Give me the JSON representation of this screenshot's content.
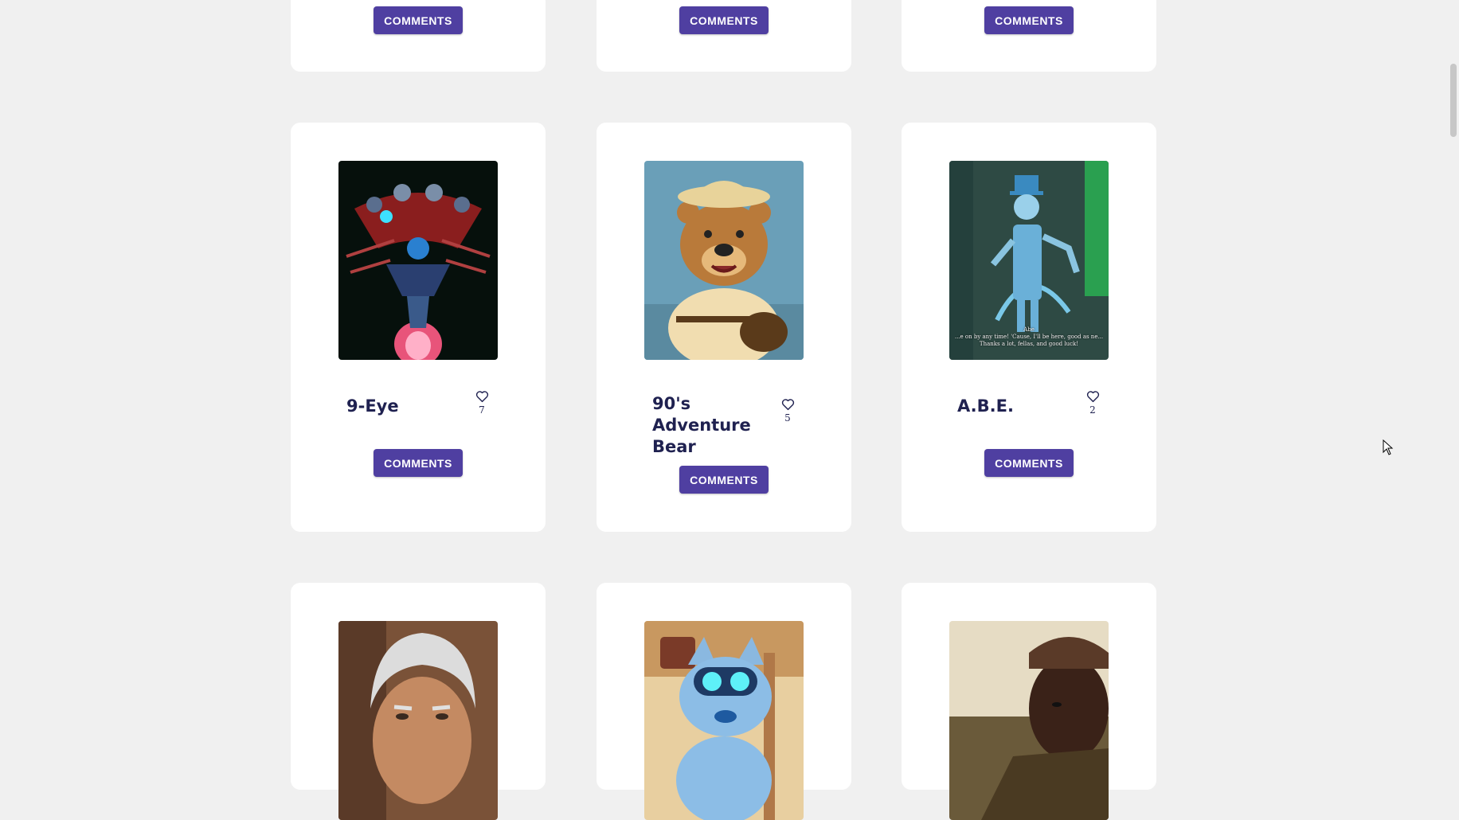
{
  "colors": {
    "page_bg": "#f0f0f0",
    "card_bg": "#ffffff",
    "accent": "#4f3fa1",
    "title_text": "#1f2150"
  },
  "button_label": "COMMENTS",
  "top_row": [
    {
      "button": "COMMENTS"
    },
    {
      "button": "COMMENTS"
    },
    {
      "button": "COMMENTS"
    }
  ],
  "characters": [
    {
      "name": "9-Eye",
      "likes": "7",
      "button": "COMMENTS",
      "image": "robot-camera-image"
    },
    {
      "name": "90's Adventure Bear",
      "likes": "5",
      "button": "COMMENTS",
      "image": "cartoon-bear-image"
    },
    {
      "name": "A.B.E.",
      "likes": "2",
      "button": "COMMENTS",
      "image": "hologram-robot-image",
      "image_caption": [
        "Abe",
        "...e on by any time! 'Cause, I'll be here, good as ne...",
        "Thanks a lot, fellas, and good luck!"
      ]
    }
  ],
  "bottom_row": [
    {
      "image": "gray-haired-man-image"
    },
    {
      "image": "robot-dog-image"
    },
    {
      "image": "man-in-hat-image"
    }
  ],
  "icons": {
    "like": "heart-icon",
    "cursor": "mouse-cursor-icon"
  }
}
